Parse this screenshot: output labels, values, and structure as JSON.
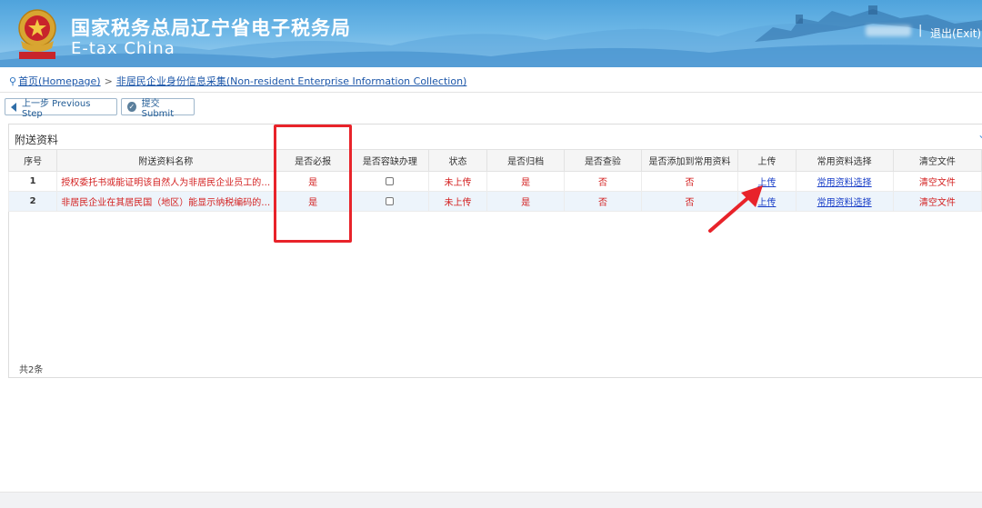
{
  "header": {
    "title_cn": "国家税务总局辽宁省电子税务局",
    "title_en": "E-tax China",
    "logout": "退出(Exit)",
    "separator": "|"
  },
  "breadcrumb": {
    "home": "首页(Homepage)",
    "separator": ">",
    "current": "非居民企业身份信息采集(Non-resident Enterprise Information Collection)"
  },
  "toolbar": {
    "prev_label": "上一步 Previous Step",
    "submit_label": "提交 Submit"
  },
  "panel": {
    "title": "附送资料",
    "collapse_icon": "chevron-down-icon"
  },
  "table": {
    "headers": [
      "序号",
      "附送资料名称",
      "是否必报",
      "是否容缺办理",
      "状态",
      "是否归档",
      "是否查验",
      "是否添加到常用资料",
      "上传",
      "常用资料选择",
      "清空文件"
    ],
    "rows": [
      {
        "index": "1",
        "name": "授权委托书或能证明该自然人为非居民企业员工的其他资料...",
        "required": "是",
        "status": "未上传",
        "archived": "是",
        "verified": "否",
        "added_common": "否",
        "upload": "上传",
        "common_select": "常用资料选择",
        "clear": "清空文件"
      },
      {
        "index": "2",
        "name": "非居民企业在其居民国（地区）能显示纳税编码的相关证件C...",
        "required": "是",
        "status": "未上传",
        "archived": "是",
        "verified": "否",
        "added_common": "否",
        "upload": "上传",
        "common_select": "常用资料选择",
        "clear": "清空文件"
      }
    ],
    "total": "共2条"
  },
  "colors": {
    "header_blue": "#4fa3dc",
    "required_red": "#d32020",
    "link_blue": "#1a3fc8",
    "annotation_red": "#e8232a"
  }
}
